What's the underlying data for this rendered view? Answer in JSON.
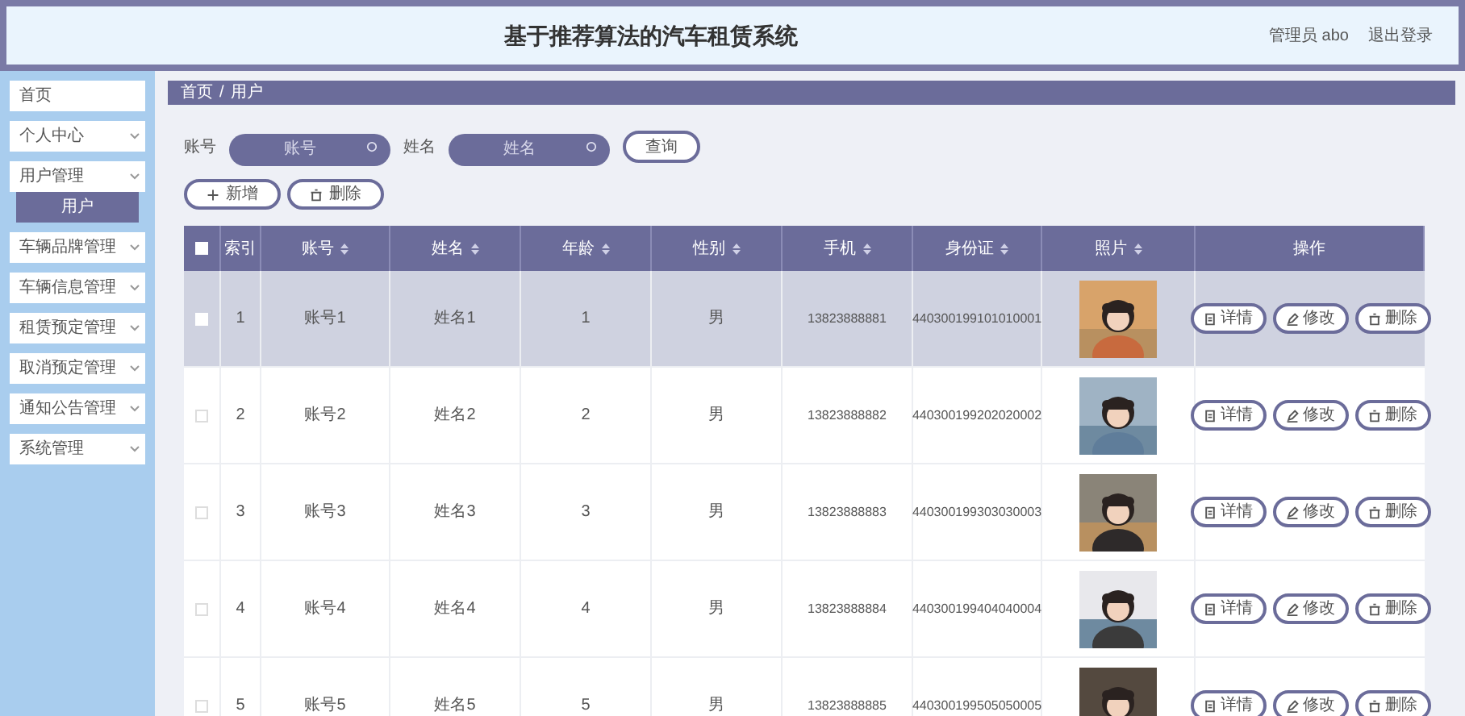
{
  "header": {
    "title": "基于推荐算法的汽车租赁系统",
    "user": "管理员 abo",
    "logout": "退出登录"
  },
  "sidebar": {
    "items": [
      {
        "label": "首页",
        "expandable": false
      },
      {
        "label": "个人中心",
        "expandable": true
      },
      {
        "label": "用户管理",
        "expandable": true,
        "children": [
          {
            "label": "用户",
            "selected": true
          }
        ]
      },
      {
        "label": "车辆品牌管理",
        "expandable": true
      },
      {
        "label": "车辆信息管理",
        "expandable": true
      },
      {
        "label": "租赁预定管理",
        "expandable": true
      },
      {
        "label": "取消预定管理",
        "expandable": true
      },
      {
        "label": "通知公告管理",
        "expandable": true
      },
      {
        "label": "系统管理",
        "expandable": true
      }
    ]
  },
  "breadcrumb": [
    "首页",
    "/",
    "用户"
  ],
  "search": {
    "fields": [
      {
        "label": "账号",
        "placeholder": "账号"
      },
      {
        "label": "姓名",
        "placeholder": "姓名"
      }
    ],
    "button": "查询"
  },
  "actions": [
    "新增",
    "删除"
  ],
  "table": {
    "all_checked": false,
    "columns": [
      {
        "label": "索引",
        "sortable": false
      },
      {
        "label": "账号",
        "sortable": true
      },
      {
        "label": "姓名",
        "sortable": true
      },
      {
        "label": "年龄",
        "sortable": true
      },
      {
        "label": "性别",
        "sortable": true
      },
      {
        "label": "手机",
        "sortable": true
      },
      {
        "label": "身份证",
        "sortable": true
      },
      {
        "label": "照片",
        "sortable": true
      },
      {
        "label": "操作",
        "sortable": false
      }
    ],
    "rows": [
      {
        "selected": true,
        "cells": [
          "1",
          "账号1",
          "姓名1",
          "1",
          "男",
          "13823888881",
          "440300199101010001"
        ],
        "buttons": [
          "详情",
          "修改",
          "删除"
        ]
      },
      {
        "selected": false,
        "cells": [
          "2",
          "账号2",
          "姓名2",
          "2",
          "男",
          "13823888882",
          "440300199202020002"
        ],
        "buttons": [
          "详情",
          "修改",
          "删除"
        ]
      },
      {
        "selected": false,
        "cells": [
          "3",
          "账号3",
          "姓名3",
          "3",
          "男",
          "13823888883",
          "440300199303030003"
        ],
        "buttons": [
          "详情",
          "修改",
          "删除"
        ]
      },
      {
        "selected": false,
        "cells": [
          "4",
          "账号4",
          "姓名4",
          "4",
          "男",
          "13823888884",
          "440300199404040004"
        ],
        "buttons": [
          "详情",
          "修改",
          "删除"
        ]
      },
      {
        "selected": false,
        "cells": [
          "5",
          "账号5",
          "姓名5",
          "5",
          "男",
          "13823888885",
          "440300199505050005"
        ],
        "buttons": [
          "详情",
          "修改",
          "删除"
        ]
      }
    ]
  }
}
